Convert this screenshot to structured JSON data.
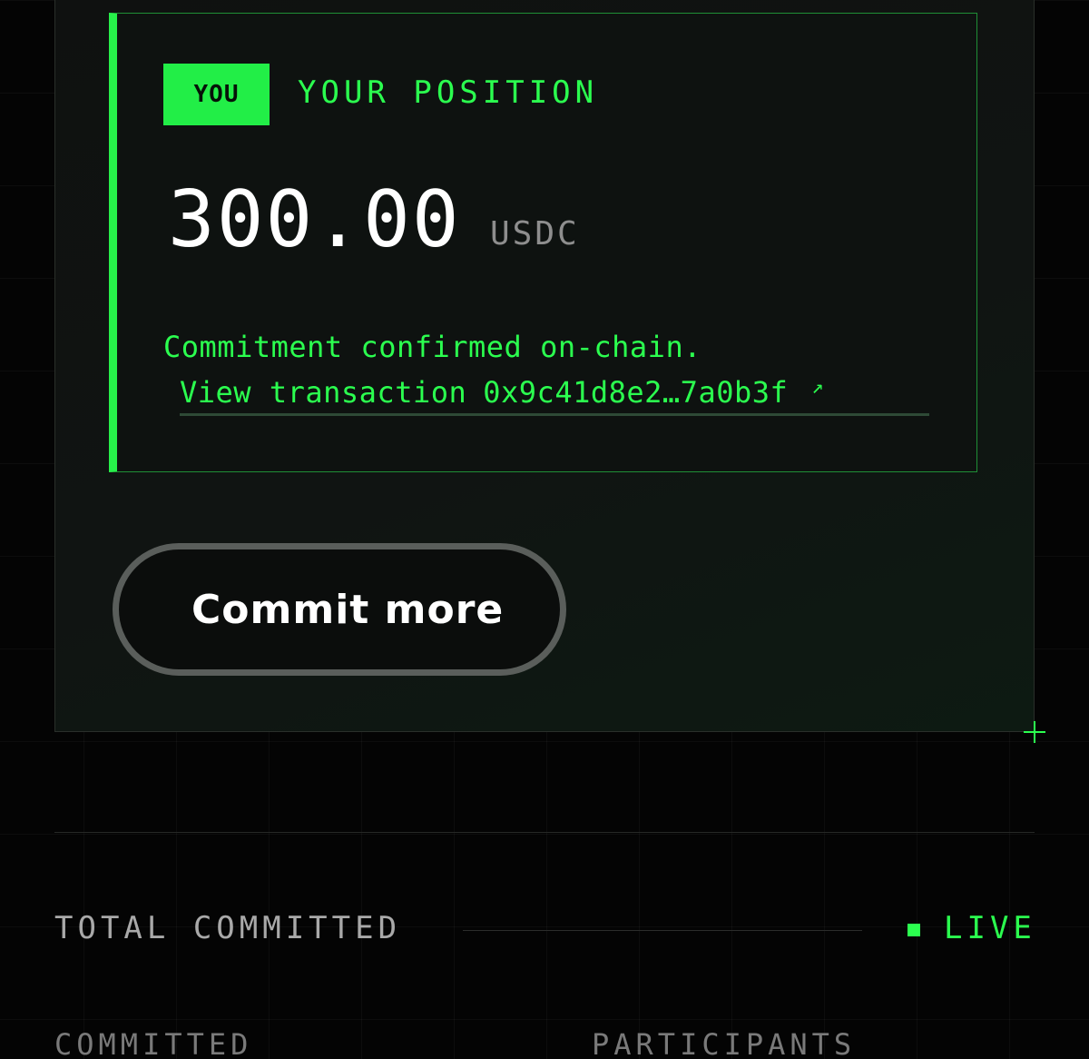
{
  "position": {
    "badge": "YOU",
    "label": "YOUR POSITION",
    "amount": "300.00",
    "unit": "USDC",
    "confirmation": "Commitment confirmed on-chain.",
    "tx_prefix": "View transaction",
    "tx_hash": "0x9c41d8e2…7a0b3f",
    "tx_icon": "↗"
  },
  "actions": {
    "commit_more_label": "Commit more"
  },
  "stats": {
    "total_label": "TOTAL COMMITTED",
    "live_label": "LIVE",
    "committed_label": "COMMITTED",
    "participants_label": "PARTICIPANTS"
  },
  "colors": {
    "accent": "#2bff4f",
    "background": "#050505",
    "muted": "#8e8e8e"
  }
}
